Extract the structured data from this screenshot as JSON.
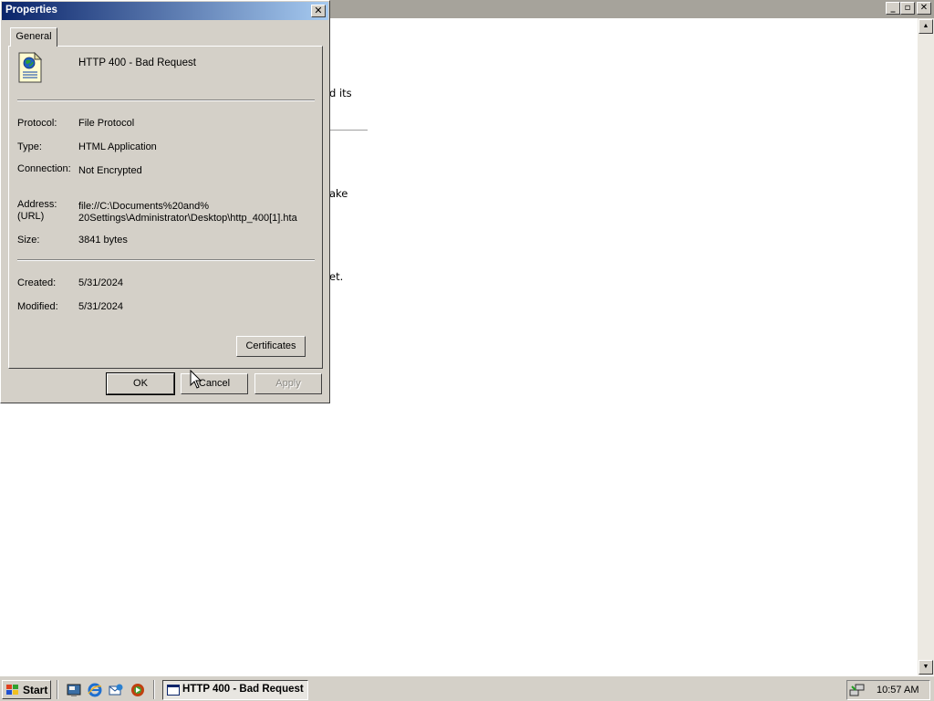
{
  "background_window": {
    "snippets": [
      "d its",
      "ake",
      "et."
    ]
  },
  "dialog": {
    "title": "Properties",
    "close_glyph": "✕",
    "tab_label": "General",
    "file_icon": "html-document-icon",
    "file_name": "HTTP 400 - Bad Request",
    "properties": {
      "protocol_label": "Protocol:",
      "protocol_value": "File Protocol",
      "type_label": "Type:",
      "type_value": "HTML Application",
      "connection_label": "Connection:",
      "connection_value": "Not Encrypted",
      "address_label_line1": "Address:",
      "address_label_line2": "(URL)",
      "address_value_line1": "file://C:\\Documents%20and%",
      "address_value_line2": "20Settings\\Administrator\\Desktop\\http_400[1].hta",
      "size_label": "Size:",
      "size_value": "3841 bytes",
      "created_label": "Created:",
      "created_value": "5/31/2024",
      "modified_label": "Modified:",
      "modified_value": "5/31/2024"
    },
    "certificates_label": "Certificates",
    "ok_label": "OK",
    "cancel_label": "Cancel",
    "apply_label": "Apply"
  },
  "taskbar": {
    "start_label": "Start",
    "quick_launch": [
      "show-desktop-icon",
      "internet-explorer-icon",
      "outlook-express-icon",
      "media-player-icon"
    ],
    "task_label": "HTTP 400 - Bad Request",
    "clock": "10:57 AM"
  },
  "colors": {
    "titlebar_start": "#0a246a",
    "titlebar_end": "#a6caf0",
    "face": "#d4d0c8"
  }
}
